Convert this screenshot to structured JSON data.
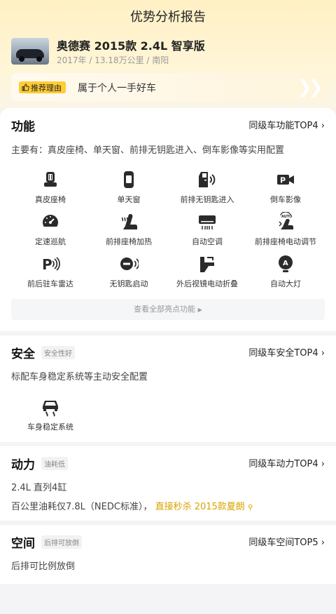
{
  "page": {
    "title": "优势分析报告"
  },
  "car": {
    "name": "奥德赛 2015款 2.4L 智享版",
    "meta": "2017年 / 13.18万公里 / 南阳",
    "reason_badge": "推荐理由",
    "reason_text": "属于个人一手好车"
  },
  "features": {
    "title": "功能",
    "rank": "同级车功能TOP4",
    "summary": "主要有：真皮座椅、单天窗、前排无钥匙进入、倒车影像等实用配置",
    "items": [
      {
        "label": "真皮座椅",
        "icon": "leather-seat-icon"
      },
      {
        "label": "单天窗",
        "icon": "sunroof-icon"
      },
      {
        "label": "前排无钥匙进入",
        "icon": "keyless-entry-icon"
      },
      {
        "label": "倒车影像",
        "icon": "reverse-camera-icon"
      },
      {
        "label": "定速巡航",
        "icon": "cruise-control-icon"
      },
      {
        "label": "前排座椅加热",
        "icon": "seat-heating-icon"
      },
      {
        "label": "自动空调",
        "icon": "auto-ac-icon"
      },
      {
        "label": "前排座椅电动调节",
        "icon": "power-seat-icon"
      },
      {
        "label": "前后驻车雷达",
        "icon": "parking-radar-icon"
      },
      {
        "label": "无钥匙启动",
        "icon": "keyless-start-icon"
      },
      {
        "label": "外后视镜电动折叠",
        "icon": "mirror-fold-icon"
      },
      {
        "label": "自动大灯",
        "icon": "auto-headlight-icon"
      }
    ],
    "view_all": "查看全部亮点功能"
  },
  "safety": {
    "title": "安全",
    "tag": "安全性好",
    "rank": "同级车安全TOP4",
    "summary": "标配车身稳定系统等主动安全配置",
    "items": [
      {
        "label": "车身稳定系统",
        "icon": "esp-icon"
      }
    ]
  },
  "power": {
    "title": "动力",
    "tag": "油耗低",
    "rank": "同级车动力TOP4",
    "engine": "2.4L 直列4缸",
    "fuel_text": "百公里油耗仅7.8L（NEDC标准），",
    "fuel_link": "直接秒杀 2015款夏朗"
  },
  "space": {
    "title": "空间",
    "tag": "后排可放倒",
    "rank": "同级车空间TOP5",
    "summary": "后排可比例放倒"
  },
  "colors": {
    "accent": "#ffcc33",
    "link": "#d8a300",
    "icon": "#2b2b2b"
  }
}
